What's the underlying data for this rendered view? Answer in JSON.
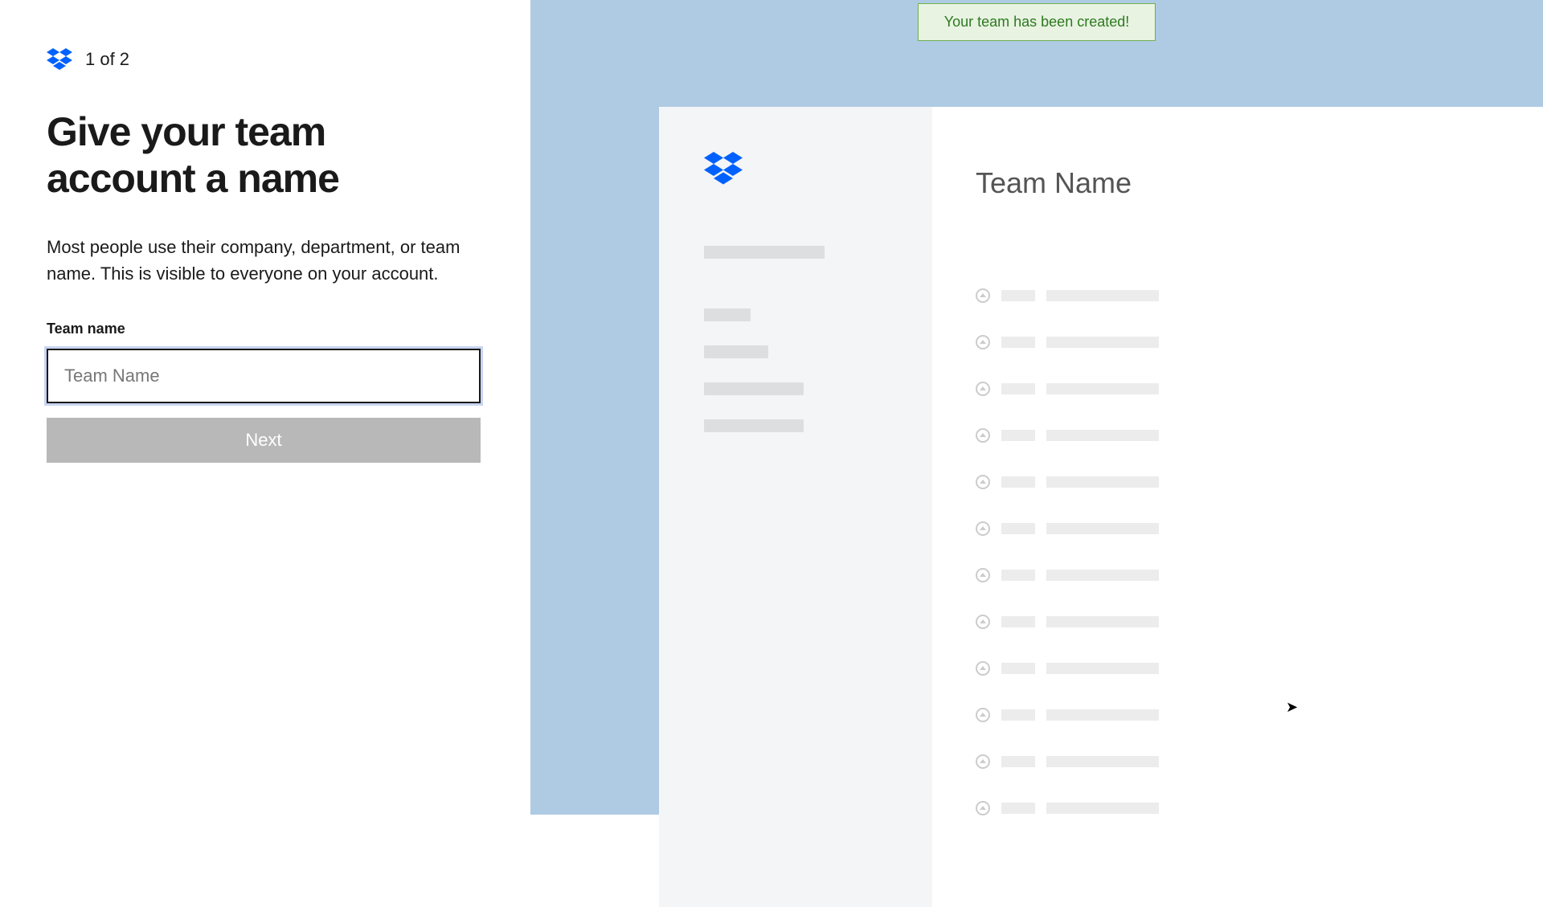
{
  "left": {
    "step": "1 of 2",
    "heading": "Give your team account a name",
    "description": "Most people use their company, department, or team name. This is visible to everyone on your account.",
    "field_label": "Team name",
    "input_placeholder": "Team Name",
    "next_label": "Next"
  },
  "right": {
    "toast": "Your team has been created!",
    "preview_title": "Team Name"
  }
}
